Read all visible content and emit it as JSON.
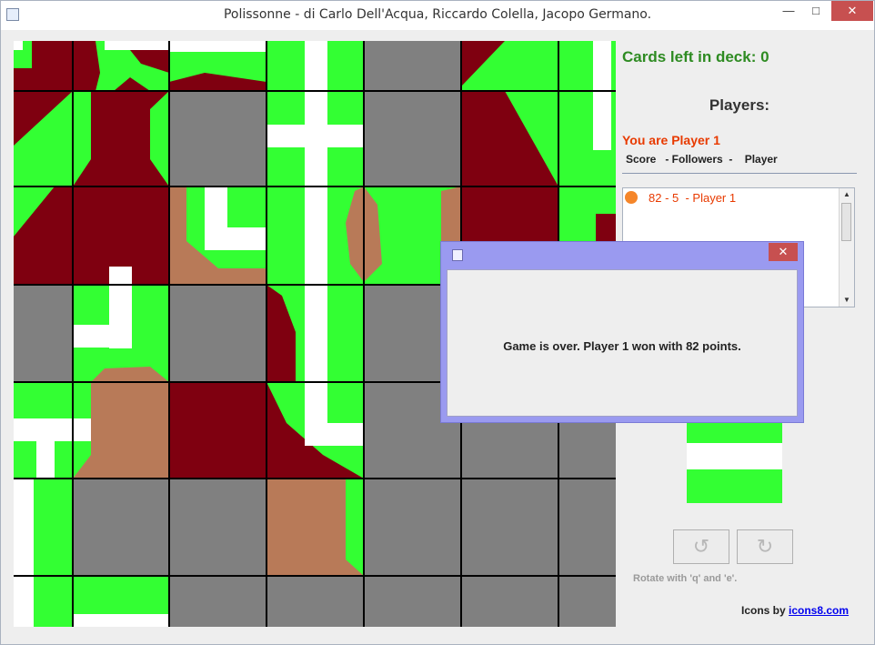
{
  "window": {
    "title": "Polissonne - di Carlo Dell'Acqua, Riccardo Colella, Jacopo Germano.",
    "minimize_glyph": "—",
    "maximize_glyph": "□",
    "close_glyph": "✕"
  },
  "colors": {
    "grass": "#33ff33",
    "road": "#ffffff",
    "city": "#7f0010",
    "monastery": "#b87a58",
    "empty_cell": "#808080",
    "accent_text": "#e83a00"
  },
  "side": {
    "deck_label": "Cards left in deck: 0",
    "players_title": "Players:",
    "you_are": "You are Player 1",
    "headers": "Score   - Followers  -    Player",
    "player_rows": [
      {
        "text": "82 - 5  - Player 1",
        "color": "#f5862a"
      }
    ]
  },
  "controls": {
    "rotate_left_icon": "rotate-ccw-icon",
    "rotate_right_icon": "rotate-cw-icon",
    "rotate_left_glyph": "↺",
    "rotate_right_glyph": "↻",
    "rotate_hint": "Rotate with 'q' and 'e'."
  },
  "credits": {
    "prefix": "Icons by ",
    "link": "icons8.com"
  },
  "dialog": {
    "close_glyph": "✕",
    "message": "Game is over. Player 1 won with 82 points."
  }
}
